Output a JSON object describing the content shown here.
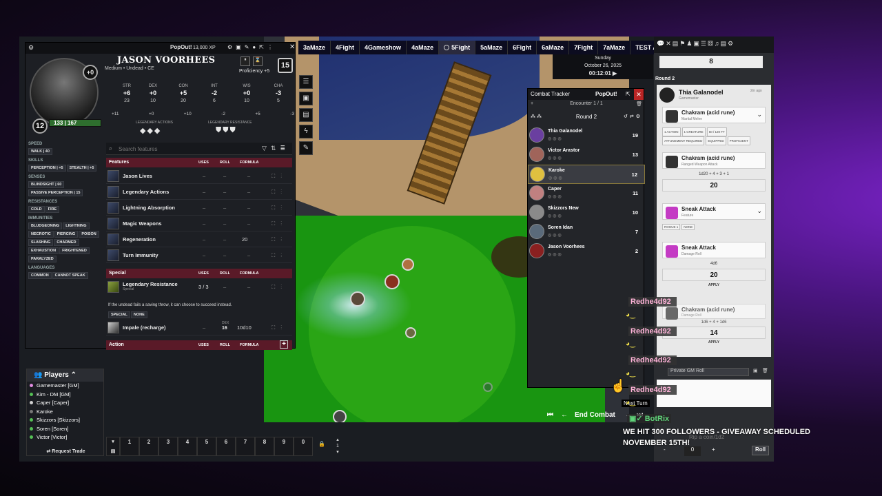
{
  "scenes": [
    {
      "label": "3aMaze",
      "active": false
    },
    {
      "label": "4Fight",
      "active": false
    },
    {
      "label": "4Gameshow",
      "active": false
    },
    {
      "label": "4aMaze",
      "active": false
    },
    {
      "label": "5Fight",
      "active": true
    },
    {
      "label": "5aMaze",
      "active": false
    },
    {
      "label": "6Fight",
      "active": false
    },
    {
      "label": "6aMaze",
      "active": false
    },
    {
      "label": "7Fight",
      "active": false
    },
    {
      "label": "7aMaze",
      "active": false
    },
    {
      "label": "TEST ARENA",
      "active": false
    }
  ],
  "calendar": {
    "day": "Sunday",
    "date": "October 26, 2025",
    "time": "00:12:01 ▶"
  },
  "sheet": {
    "popout": "PopOut!",
    "xp": "13,000 XP",
    "name": "JASON VOORHEES",
    "subtitle": "Medium • Undead • CE",
    "proficiency": "Proficiency +5",
    "ac": "15",
    "level": "12",
    "initiative": "+0",
    "hp": "133 | 167",
    "hp_fraction": 0.796,
    "abilities": [
      {
        "key": "STR",
        "mod": "+6",
        "score": "23",
        "save": "+11"
      },
      {
        "key": "DEX",
        "mod": "+0",
        "score": "10",
        "save": "+0"
      },
      {
        "key": "CON",
        "mod": "+5",
        "score": "20",
        "save": "+10"
      },
      {
        "key": "INT",
        "mod": "-2",
        "score": "6",
        "save": "-2"
      },
      {
        "key": "WIS",
        "mod": "+0",
        "score": "10",
        "save": "+5"
      },
      {
        "key": "CHA",
        "mod": "-3",
        "score": "5",
        "save": "-3"
      }
    ],
    "legendary_actions_label": "LEGENDARY ACTIONS",
    "legendary_resistance_label": "LEGENDARY RESISTANCE",
    "side": {
      "speed_hdr": "SPEED",
      "speed": [
        "WALK | 40"
      ],
      "skills_hdr": "SKILLS",
      "skills": [
        "PERCEPTION | +5",
        "STEALTH | +5"
      ],
      "senses_hdr": "SENSES",
      "senses": [
        "BLINDSIGHT | 60",
        "PASSIVE PERCEPTION | 15"
      ],
      "resist_hdr": "RESISTANCES",
      "resist": [
        "COLD",
        "FIRE"
      ],
      "immune_hdr": "IMMUNITIES",
      "immune": [
        "BLUDGEONING",
        "LIGHTNING",
        "NECROTIC",
        "PIERCING",
        "POISON",
        "SLASHING",
        "CHARMED",
        "EXHAUSTION",
        "FRIGHTENED",
        "PARALYZED"
      ],
      "lang_hdr": "LANGUAGES",
      "lang": [
        "COMMON",
        "CANNOT SPEAK"
      ]
    },
    "search_placeholder": "Search features",
    "features_hdr": {
      "title": "Features",
      "uses": "USES",
      "roll": "ROLL",
      "formula": "FORMULA"
    },
    "features": [
      {
        "name": "Jason Lives",
        "uses": "–",
        "roll": "–",
        "formula": "–"
      },
      {
        "name": "Legendary Actions",
        "uses": "–",
        "roll": "–",
        "formula": "–"
      },
      {
        "name": "Lightning Absorption",
        "uses": "–",
        "roll": "–",
        "formula": "–"
      },
      {
        "name": "Magic Weapons",
        "uses": "–",
        "roll": "–",
        "formula": "–"
      },
      {
        "name": "Regeneration",
        "uses": "–",
        "roll": "–",
        "formula": "20"
      },
      {
        "name": "Turn Immunity",
        "uses": "–",
        "roll": "–",
        "formula": "–"
      }
    ],
    "special_hdr": {
      "title": "Special",
      "uses": "USES",
      "roll": "ROLL",
      "formula": "FORMULA"
    },
    "special": {
      "name": "Legendary Resistance",
      "sub": "Special",
      "uses": "3 / 3",
      "roll": "–",
      "formula": "–",
      "desc": "If the undead fails a saving throw, it can choose to succeed instead.",
      "tags": [
        "SPECIAL",
        "NONE"
      ]
    },
    "impale": {
      "name": "Impale (recharge)",
      "uses": "–",
      "roll_label": "DEX",
      "roll": "16",
      "formula": "10d10"
    },
    "action_hdr": {
      "title": "Action",
      "uses": "USES",
      "roll": "ROLL",
      "formula": "FORMULA"
    }
  },
  "combat": {
    "title": "Combat Tracker",
    "popout": "PopOut!",
    "encounter": "Encounter 1 / 1",
    "round": "Round 2",
    "combatants": [
      {
        "name": "Thia Galanodel",
        "init": "19",
        "active": false,
        "color": "#6a3fa0"
      },
      {
        "name": "Victor Arastor",
        "init": "13",
        "active": false,
        "color": "#a0645a"
      },
      {
        "name": "Karoke",
        "init": "12",
        "active": true,
        "color": "#e0c040"
      },
      {
        "name": "Caper",
        "init": "11",
        "active": false,
        "color": "#c08080"
      },
      {
        "name": "Skizzors New",
        "init": "10",
        "active": false,
        "color": "#8a8a8a"
      },
      {
        "name": "Soren Idan",
        "init": "7",
        "active": false,
        "color": "#5a6a7a"
      },
      {
        "name": "Jason Voorhees",
        "init": "2",
        "active": false,
        "color": "#8a2020"
      }
    ],
    "end_combat": "End Combat",
    "next_turn": "Next Turn"
  },
  "chat": {
    "top_total": "8",
    "round_label": "Round 2",
    "speaker": "Thia Galanodel",
    "speaker_role": "Gamemaster",
    "time_ago": "2m ago",
    "card1": {
      "title": "Chakram (acid rune)",
      "sub": "Martial Melee",
      "tags": [
        "1 ACTION",
        "1 CREATURE",
        "60 / 120 FT",
        "ATTUNEMENT REQUIRED",
        "EQUIPPED",
        "PROFICIENT"
      ]
    },
    "card2": {
      "title": "Chakram (acid rune)",
      "sub": "Ranged Weapon Attack",
      "formula": "1d20 + 4 + 3 + 1",
      "total": "20"
    },
    "card3": {
      "title": "Sneak Attack",
      "sub": "Feature",
      "tags": [
        "ROGUE 1",
        "NONE"
      ]
    },
    "card4": {
      "title": "Sneak Attack",
      "sub": "Damage Roll",
      "formula": "4d6",
      "total": "20",
      "apply": "APPLY"
    },
    "card5": {
      "title": "Chakram (acid rune)",
      "sub": "Damage Roll",
      "formula": "1d6 + 4 + 1d6",
      "total": "14",
      "apply": "APPLY"
    },
    "roll_mode": "Private GM Roll",
    "roll_button": "Roll",
    "adv_value": "0"
  },
  "twitch": {
    "user": "Redhe4d92",
    "bot": "BotRix",
    "bot_message": "WE HIT 300 FOLLOWERS - GIVEAWAY SCHEDULED NOVEMBER 15TH!",
    "bot_sub": "Rip a coin/1d2"
  },
  "players": {
    "title": "Players",
    "list": [
      {
        "name": "Gamemaster [GM]",
        "color": "#e08be0"
      },
      {
        "name": "Kim - DM [GM]",
        "color": "#55c055"
      },
      {
        "name": "Caper [Caper]",
        "color": "#d0d0d0"
      },
      {
        "name": "Karoke",
        "color": "#777"
      },
      {
        "name": "Skizzors [Skizzors]",
        "color": "#55c055"
      },
      {
        "name": "Soren [Soren]",
        "color": "#55c055"
      },
      {
        "name": "Victor [Victor]",
        "color": "#55c055"
      }
    ],
    "request_trade": "Request Trade"
  },
  "macros": [
    "1",
    "2",
    "3",
    "4",
    "5",
    "6",
    "7",
    "8",
    "9",
    "0"
  ],
  "macro_page": "1"
}
